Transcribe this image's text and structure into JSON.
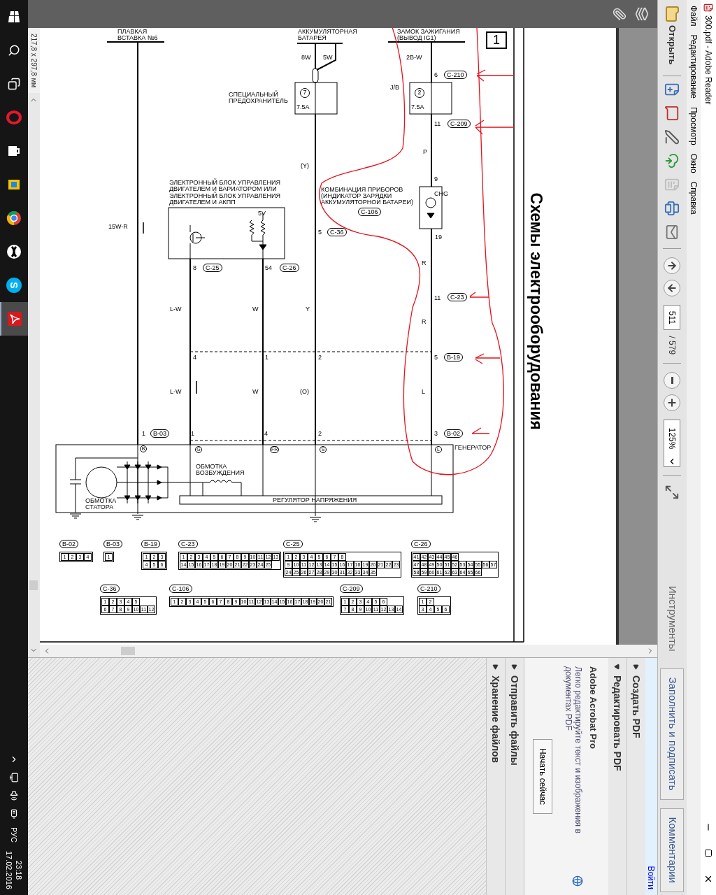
{
  "title_bar": {
    "title": "300.pdf - Adobe Reader"
  },
  "menu": [
    "Файл",
    "Редактирование",
    "Просмотр",
    "Окно",
    "Справка"
  ],
  "toolbar": {
    "open": "Открыть",
    "page": "511",
    "page_total": "/ 579",
    "zoom": "125%"
  },
  "panel_tabs": [
    {
      "label": "Инструменты",
      "selected": true
    },
    {
      "label": "Заполнить и подписать",
      "selected": false
    },
    {
      "label": "Комментарии",
      "selected": false
    }
  ],
  "sign_in": "Войти",
  "tools_pane": {
    "sections": [
      {
        "title": "Создать PDF",
        "expanded": false
      },
      {
        "title": "Редактировать PDF",
        "expanded": true
      },
      {
        "title": "Отправить файлы",
        "expanded": false
      },
      {
        "title": "Хранение файлов",
        "expanded": false
      }
    ],
    "promo": {
      "title": "Adobe Acrobat Pro",
      "text": "Легко редактируйте текст и изображения в документах PDF",
      "button": "Начать сейчас"
    }
  },
  "diagram": {
    "page_number": "1",
    "title": "Схемы электрооборудования",
    "labels": [
      "ПЛАВКАЯ",
      "ВСТАВКА №6",
      "АККУМУЛЯТОРНАЯ",
      "БАТАРЕЯ",
      "ЗАМОК ЗАЖИГАНИЯ",
      "(ВЫВОД IG1)",
      "8W",
      "5W",
      "2B-W",
      "6",
      "J/B",
      "СПЕЦИАЛЬНЫЙ",
      "ПРЕДОХРАНИТЕЛЬ",
      "11",
      "P",
      "(Y)",
      "9",
      "КОМБИНАЦИЯ ПРИБОРОВ",
      "(ИНДИКАТОР ЗАРЯДКИ",
      "АККУМУЛЯТОРНОЙ БАТАРЕИ)",
      "ЭЛЕКТРОННЫЙ БЛОК УПРАВЛЕНИЯ",
      "ДВИГАТЕЛЕМ И ВАРИАТОРОМ ИЛИ",
      "ЭЛЕКТРОННЫЙ БЛОК УПРАВЛЕНИЯ",
      "ДВИГАТЕЛЕМ И АКПП",
      "5V",
      "CHG",
      "15W-R",
      "5",
      "19",
      "R",
      "8",
      "54",
      "11",
      "L-W",
      "W",
      "Y",
      "R",
      "4",
      "1",
      "2",
      "5",
      "L-W",
      "W",
      "(O)",
      "L",
      "1",
      "1",
      "4",
      "2",
      "3",
      "ГЕНЕРАТОР",
      "ОБМОТКА",
      "ВОЗБУЖДЕНИЯ",
      "ОБМОТКА",
      "СТАТОРА",
      "РЕГУЛЯТОР НАПРЯЖЕНИЯ"
    ],
    "tags": [
      "C-210",
      "C-209",
      "C-106",
      "C-36",
      "C-25",
      "C-26",
      "C-23",
      "B-19",
      "B-03",
      "B-02"
    ],
    "fuses": [
      {
        "number": "7",
        "rating": "7.5A"
      },
      {
        "number": "2",
        "rating": "7.5A"
      }
    ],
    "terminals": [
      "B",
      "G",
      "FR",
      "S",
      "L"
    ],
    "connectors": [
      {
        "label": "B-02",
        "rows": [
          [
            "1",
            "2",
            "3",
            "4"
          ]
        ]
      },
      {
        "label": "B-03",
        "rows": [
          [
            "1"
          ]
        ]
      },
      {
        "label": "B-19",
        "rows": [
          [
            "1",
            "2",
            "3"
          ],
          [
            "4",
            "5",
            "6"
          ]
        ]
      },
      {
        "label": "C-23",
        "rows": [
          [
            "1",
            "2",
            "3",
            "4",
            "5",
            "6",
            "7",
            "8",
            "9",
            "10",
            "11",
            "12",
            "13"
          ],
          [
            "14",
            "15",
            "16",
            "17",
            "18",
            "19",
            "20",
            "21",
            "22",
            "23",
            "24",
            "25"
          ]
        ]
      },
      {
        "label": "C-25",
        "rows": [
          [
            "1",
            "2",
            "3",
            "4",
            "5",
            "6",
            "7",
            "8"
          ],
          [
            "9",
            "10",
            "11",
            "12",
            "13",
            "14",
            "15",
            "16",
            "17",
            "18",
            "19",
            "20",
            "21",
            "22",
            "23"
          ],
          [
            "24",
            "25",
            "26",
            "27",
            "28",
            "29",
            "30",
            "31",
            "32",
            "33",
            "34",
            "35"
          ]
        ]
      },
      {
        "label": "C-26",
        "rows": [
          [
            "41",
            "42",
            "43",
            "44",
            "45",
            "46"
          ],
          [
            "47",
            "48",
            "49",
            "50",
            "51",
            "52",
            "53",
            "54",
            "55",
            "56",
            "57"
          ],
          [
            "58",
            "59",
            "60",
            "61",
            "62",
            "63",
            "64",
            "65",
            "66"
          ]
        ]
      },
      {
        "label": "C-36",
        "rows": [
          [
            "1",
            "2",
            "3",
            "4",
            "5"
          ],
          [
            "6",
            "7",
            "8",
            "9",
            "10",
            "11",
            "12"
          ]
        ]
      },
      {
        "label": "C-106",
        "rows": [
          [
            "1",
            "2",
            "3",
            "4",
            "5",
            "6",
            "7",
            "8",
            "9",
            "10",
            "11",
            "12",
            "13",
            "14",
            "15",
            "16",
            "17",
            "18",
            "19",
            "20",
            "21"
          ]
        ]
      },
      {
        "label": "C-209",
        "rows": [
          [
            "1",
            "2",
            "3",
            "4",
            "5",
            "6"
          ],
          [
            "7",
            "8",
            "9",
            "10",
            "11",
            "12",
            "13",
            "14"
          ]
        ]
      },
      {
        "label": "C-210",
        "rows": [
          [
            "1",
            "2"
          ],
          [
            "3",
            "4",
            "5",
            "6"
          ]
        ]
      }
    ]
  },
  "status_bar": {
    "page_size": "217,8 x 297,8 мм"
  },
  "taskbar": {
    "apps": [
      {
        "kind": "start",
        "active": false
      },
      {
        "kind": "search",
        "active": false
      },
      {
        "kind": "taskview",
        "active": false
      },
      {
        "kind": "ring",
        "active": false
      },
      {
        "kind": "bag",
        "active": false
      },
      {
        "kind": "notes",
        "active": false
      },
      {
        "kind": "browser",
        "active": false
      },
      {
        "kind": "ball",
        "active": false
      },
      {
        "kind": "messenger",
        "glyph": "S",
        "active": false
      },
      {
        "kind": "reader",
        "active": true
      }
    ],
    "language": "РУС",
    "time": "23:18",
    "date": "17.02.2016"
  }
}
